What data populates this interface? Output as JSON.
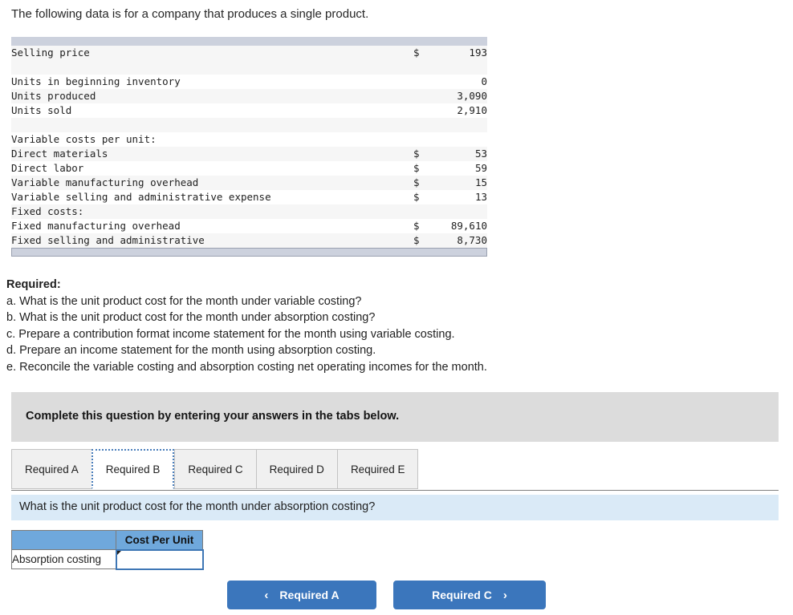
{
  "intro": {
    "text": "The following data is for a company that produces a single product."
  },
  "exhibit": {
    "rows": [
      {
        "label": "Selling price",
        "indent": 0,
        "currency": "$",
        "value": "193",
        "shade": "alt"
      },
      {
        "label": "",
        "indent": 0,
        "currency": "",
        "value": "",
        "shade": "spacer"
      },
      {
        "label": "Units in beginning inventory",
        "indent": 0,
        "currency": "",
        "value": "0",
        "shade": "plain"
      },
      {
        "label": "Units produced",
        "indent": 0,
        "currency": "",
        "value": "3,090",
        "shade": "alt"
      },
      {
        "label": "Units sold",
        "indent": 0,
        "currency": "",
        "value": "2,910",
        "shade": "plain"
      },
      {
        "label": "",
        "indent": 0,
        "currency": "",
        "value": "",
        "shade": "spacer"
      },
      {
        "label": "Variable costs per unit:",
        "indent": 0,
        "currency": "",
        "value": "",
        "shade": "plain"
      },
      {
        "label": "Direct materials",
        "indent": 1,
        "currency": "$",
        "value": "53",
        "shade": "alt"
      },
      {
        "label": "Direct labor",
        "indent": 1,
        "currency": "$",
        "value": "59",
        "shade": "plain"
      },
      {
        "label": "Variable manufacturing overhead",
        "indent": 1,
        "currency": "$",
        "value": "15",
        "shade": "alt"
      },
      {
        "label": "Variable selling and administrative expense",
        "indent": 1,
        "currency": "$",
        "value": "13",
        "shade": "plain"
      },
      {
        "label": "Fixed costs:",
        "indent": 0,
        "currency": "",
        "value": "",
        "shade": "alt"
      },
      {
        "label": "Fixed manufacturing overhead",
        "indent": 1,
        "currency": "$",
        "value": "89,610",
        "shade": "plain"
      },
      {
        "label": "Fixed selling and administrative",
        "indent": 1,
        "currency": "$",
        "value": "8,730",
        "shade": "alt"
      }
    ]
  },
  "required": {
    "heading": "Required:",
    "items": [
      "a. What is the unit product cost for the month under variable costing?",
      "b. What is the unit product cost for the month under absorption costing?",
      "c. Prepare a contribution format income statement for the month using variable costing.",
      "d. Prepare an income statement for the month using absorption costing.",
      "e. Reconcile the variable costing and absorption costing net operating incomes for the month."
    ]
  },
  "banner": {
    "text": "Complete this question by entering your answers in the tabs below."
  },
  "tabs": {
    "items": [
      {
        "label": "Required A",
        "active": false
      },
      {
        "label": "Required B",
        "active": true
      },
      {
        "label": "Required C",
        "active": false
      },
      {
        "label": "Required D",
        "active": false
      },
      {
        "label": "Required E",
        "active": false
      }
    ]
  },
  "question_bar": {
    "text": "What is the unit product cost for the month under absorption costing?"
  },
  "answer_table": {
    "header_blank": "",
    "header_label": "Cost Per Unit",
    "row_label": "Absorption costing",
    "input_value": "",
    "input_placeholder": ""
  },
  "nav": {
    "prev_label": "Required A",
    "next_label": "Required C",
    "prev_icon": "chevron-left",
    "next_icon": "chevron-right",
    "prev_glyph": "‹",
    "next_glyph": "›"
  },
  "colors": {
    "button_blue": "#3b76bc",
    "question_bar_blue": "#daeaf7",
    "table_header_blue": "#6fa8dc",
    "banner_gray": "#dcdcdc",
    "exhibit_cap_gray": "#ccd1dd"
  }
}
